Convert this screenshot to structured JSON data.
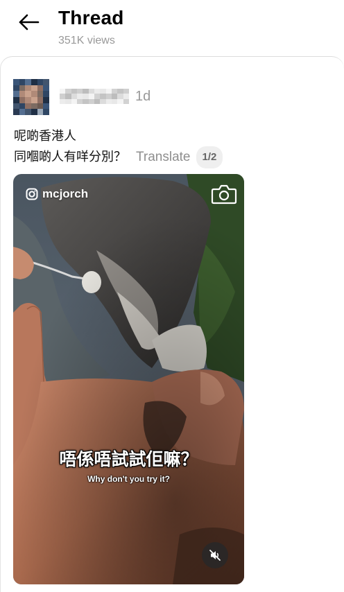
{
  "header": {
    "title": "Thread",
    "views": "351K views"
  },
  "post": {
    "timestamp": "1d",
    "line1": "呢啲香港人",
    "line2": "同嗰啲人有咩分別？",
    "translate_label": "Translate",
    "page_indicator": "1/2",
    "media": {
      "watermark_handle": "mcjorch",
      "subtitle_main": "唔係唔試試佢嘛？",
      "subtitle_english": "Why don't you try it?",
      "muted": true
    }
  },
  "icons": {
    "back": "arrow-left-icon",
    "watermark": "instagram-icon",
    "camera": "camera-icon",
    "mute": "speaker-muted-icon"
  }
}
